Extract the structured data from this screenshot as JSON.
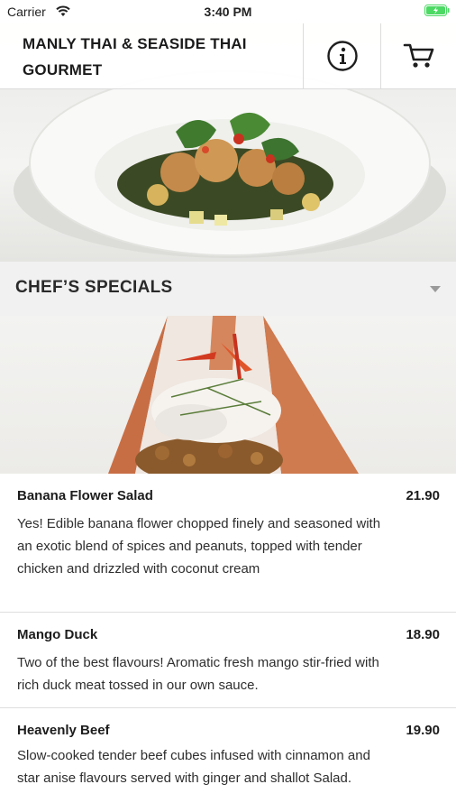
{
  "status_bar": {
    "carrier": "Carrier",
    "time": "3:40 PM"
  },
  "header": {
    "title": "MANLY THAI & SEASIDE THAI GOURMET",
    "info_icon": "info-icon",
    "cart_icon": "cart-icon"
  },
  "section": {
    "title": "CHEF’S SPECIALS",
    "chevron_icon": "chevron-down-icon"
  },
  "menu_items": [
    {
      "name": "Banana Flower Salad",
      "price": "21.90",
      "description": "Yes! Edible banana flower chopped finely and seasoned with an exotic blend of spices and peanuts, topped with tender chicken and drizzled with coconut cream"
    },
    {
      "name": "Mango Duck",
      "price": "18.90",
      "description": "Two of the best flavours! Aromatic fresh mango stir-fried with rich duck meat tossed in our own sauce."
    },
    {
      "name": "Heavenly Beef",
      "price": "19.90",
      "description": "Slow-cooked tender beef cubes infused with cinnamon and star anise flavours served with ginger and shallot Salad."
    }
  ],
  "colors": {
    "battery": "#4cd964",
    "divider": "#dcdcdc",
    "section_bg": "#f1f1f1"
  }
}
